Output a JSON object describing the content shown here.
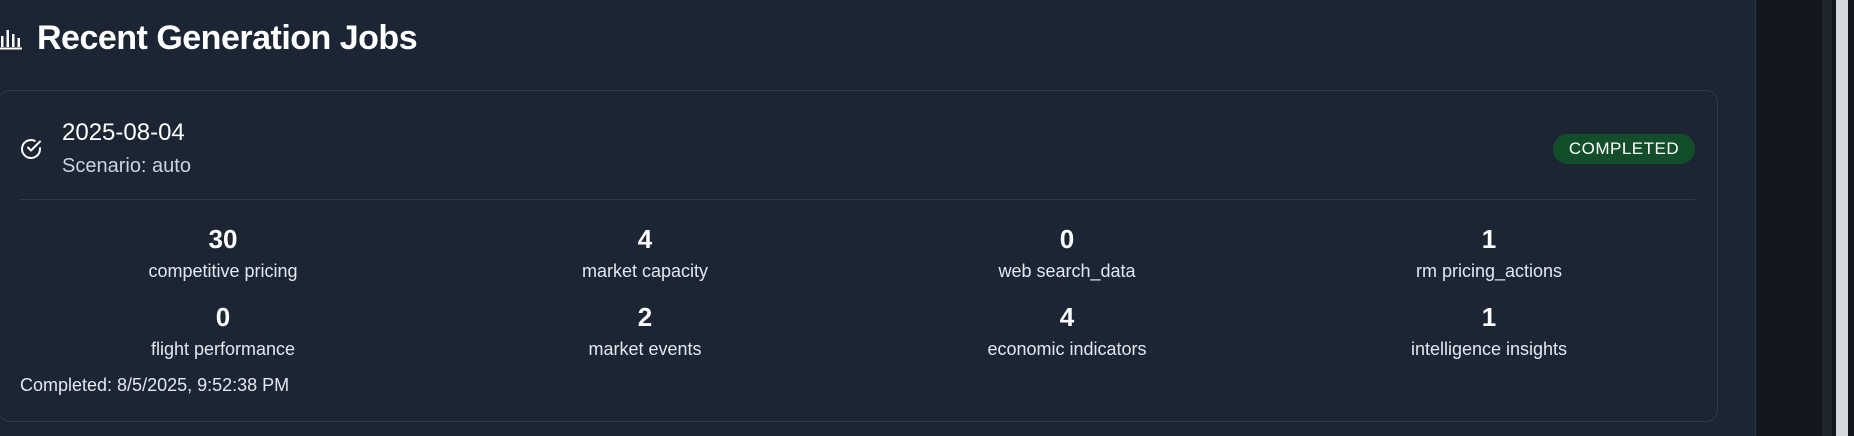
{
  "header": {
    "title": "Recent Generation Jobs",
    "icon": "bar-chart-icon"
  },
  "job": {
    "date": "2025-08-04",
    "scenario": "Scenario: auto",
    "status": "COMPLETED",
    "status_icon": "check-circle-icon",
    "status_color": "#134e2a",
    "completed_at": "Completed: 8/5/2025, 9:52:38 PM",
    "stats": [
      {
        "value": "30",
        "label": "competitive pricing"
      },
      {
        "value": "4",
        "label": "market capacity"
      },
      {
        "value": "0",
        "label": "web search_data"
      },
      {
        "value": "1",
        "label": "rm pricing_actions"
      },
      {
        "value": "0",
        "label": "flight performance"
      },
      {
        "value": "2",
        "label": "market events"
      },
      {
        "value": "4",
        "label": "economic indicators"
      },
      {
        "value": "1",
        "label": "intelligence insights"
      }
    ]
  }
}
